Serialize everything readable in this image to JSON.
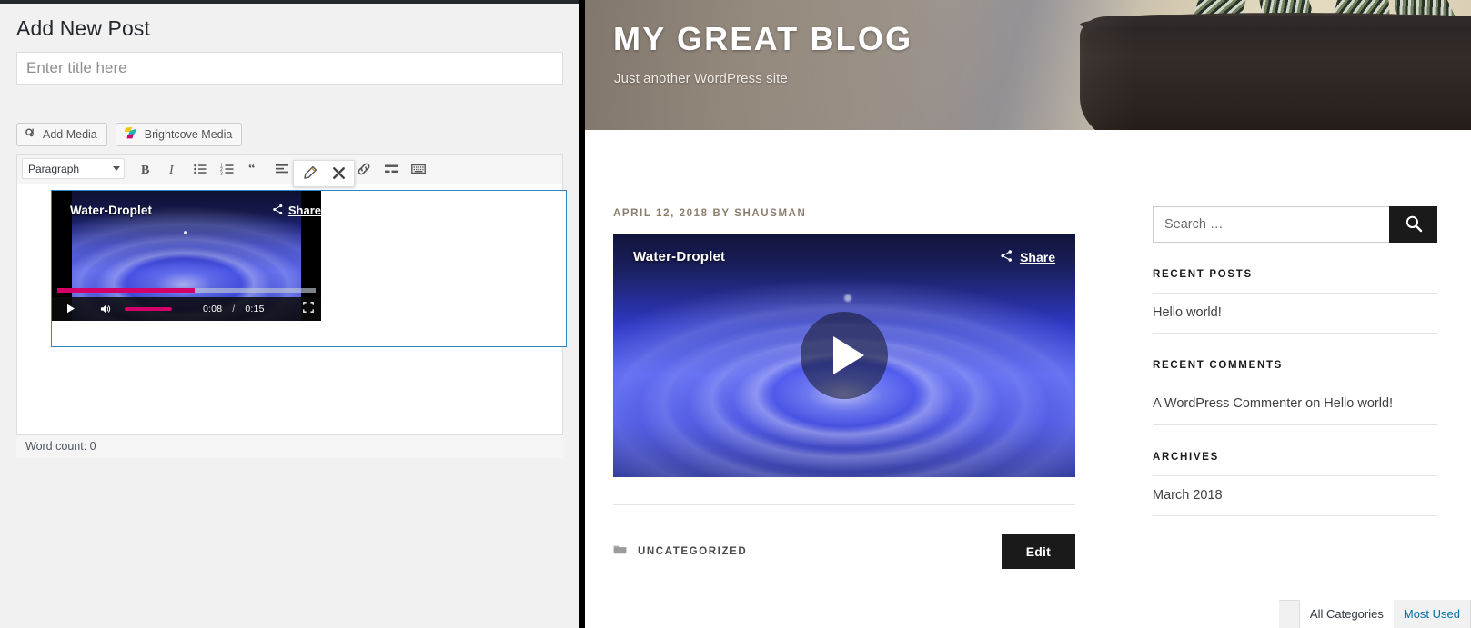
{
  "admin": {
    "page_title": "Add New Post",
    "title_input": {
      "value": "",
      "placeholder": "Enter title here"
    },
    "buttons": {
      "add_media": "Add Media",
      "brightcove_media": "Brightcove Media"
    },
    "toolbar": {
      "format_select": "Paragraph",
      "items": [
        {
          "name": "bold",
          "label": "B"
        },
        {
          "name": "italic",
          "label": "I"
        },
        {
          "name": "bulleted-list",
          "label": ""
        },
        {
          "name": "numbered-list",
          "label": ""
        },
        {
          "name": "blockquote",
          "label": ""
        },
        {
          "name": "align-left",
          "label": ""
        },
        {
          "name": "align-center",
          "label": ""
        },
        {
          "name": "align-right",
          "label": ""
        },
        {
          "name": "insert-link",
          "label": ""
        },
        {
          "name": "read-more",
          "label": ""
        },
        {
          "name": "keyboard-shortcuts",
          "label": ""
        }
      ]
    },
    "embed": {
      "video_title": "Water-Droplet",
      "share_label": "Share",
      "current_time": "0:08",
      "time_separator": "/",
      "duration": "0:15",
      "progress_percent": 53
    },
    "word_count": "Word count: 0",
    "category_tabs": [
      {
        "label": "All Categories",
        "active": true
      },
      {
        "label": "Most Used",
        "active": false
      }
    ]
  },
  "site": {
    "title": "MY GREAT BLOG",
    "tagline": "Just another WordPress site",
    "post": {
      "meta": "APRIL 12, 2018 BY SHAUSMAN",
      "video_title": "Water-Droplet",
      "share_label": "Share",
      "category": "UNCATEGORIZED",
      "edit_label": "Edit"
    },
    "sidebar": {
      "search": {
        "value": "",
        "placeholder": "Search …"
      },
      "widgets": [
        {
          "title": "RECENT POSTS",
          "items": [
            "Hello world!"
          ]
        },
        {
          "title": "RECENT COMMENTS",
          "items": [
            "A WordPress Commenter on Hello world!"
          ]
        },
        {
          "title": "ARCHIVES",
          "items": [
            "March 2018"
          ]
        }
      ]
    }
  },
  "colors": {
    "admin_bg": "#f1f1f1",
    "accent_blue": "#0073aa",
    "selection_border": "#2e87c4",
    "player_progress": "#d4006a",
    "site_dark": "#1a1a1a",
    "meta_tan": "#8a7f6d"
  }
}
